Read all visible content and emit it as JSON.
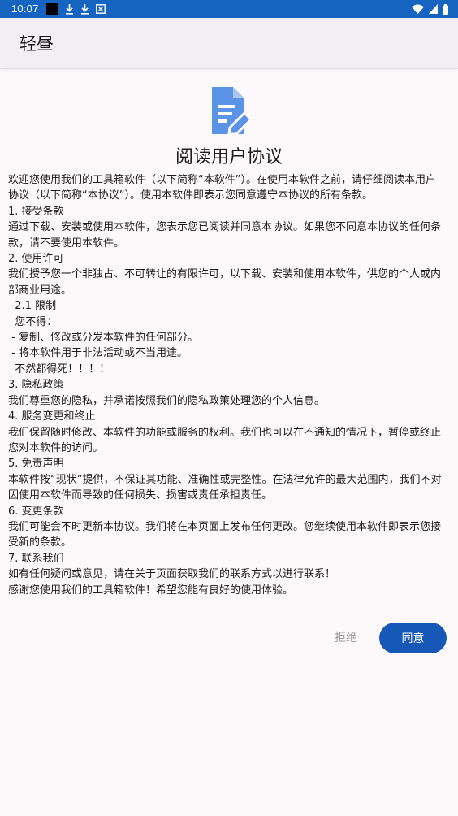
{
  "status_bar": {
    "time": "10:07",
    "left_icons": [
      "black-square-icon",
      "download-icon",
      "download-icon",
      "x-box-icon"
    ],
    "right_icons": [
      "wifi-icon",
      "signal-icon",
      "battery-icon"
    ],
    "background": "#1565c0"
  },
  "app_bar": {
    "title": "轻昼"
  },
  "agreement": {
    "icon": "document-edit-icon",
    "icon_color": "#5b93e6",
    "title": "阅读用户协议",
    "lines": [
      "欢迎您使用我们的工具箱软件（以下简称“本软件”）。在使用本软件之前，请仔细阅读本用户",
      "协议（以下简称“本协议”）。使用本软件即表示您同意遵守本协议的所有条款。",
      "1. 接受条款",
      "通过下载、安装或使用本软件，您表示您已阅读并同意本协议。如果您不同意本协议的任何条",
      "款，请不要使用本软件。",
      "2. 使用许可",
      "我们授予您一个非独占、不可转让的有限许可，以下载、安装和使用本软件，供您的个人或内",
      "部商业用途。",
      "  2.1 限制",
      "  您不得：",
      " - 复制、修改或分发本软件的任何部分。",
      " - 将本软件用于非法活动或不当用途。",
      "  不然都得死！！！！",
      "3. 隐私政策",
      "我们尊重您的隐私，并承诺按照我们的隐私政策处理您的个人信息。",
      "4. 服务变更和终止",
      "我们保留随时修改、本软件的功能或服务的权利。我们也可以在不通知的情况下，暂停或终止",
      "您对本软件的访问。",
      "5. 免责声明",
      "本软件按“现状”提供，不保证其功能、准确性或完整性。在法律允许的最大范围内，我们不对",
      "因使用本软件而导致的任何损失、损害或责任承担责任。",
      "6. 变更条款",
      "我们可能会不时更新本协议。我们将在本页面上发布任何更改。您继续使用本软件即表示您接",
      "受新的条款。",
      "7. 联系我们",
      "如有任何疑问或意见，请在关于页面获取我们的联系方式以进行联系！",
      "感谢您使用我们的工具箱软件！希望您能有良好的使用体验。"
    ],
    "reject_label": "拒绝",
    "agree_label": "同意",
    "agree_color": "#1558b8"
  }
}
